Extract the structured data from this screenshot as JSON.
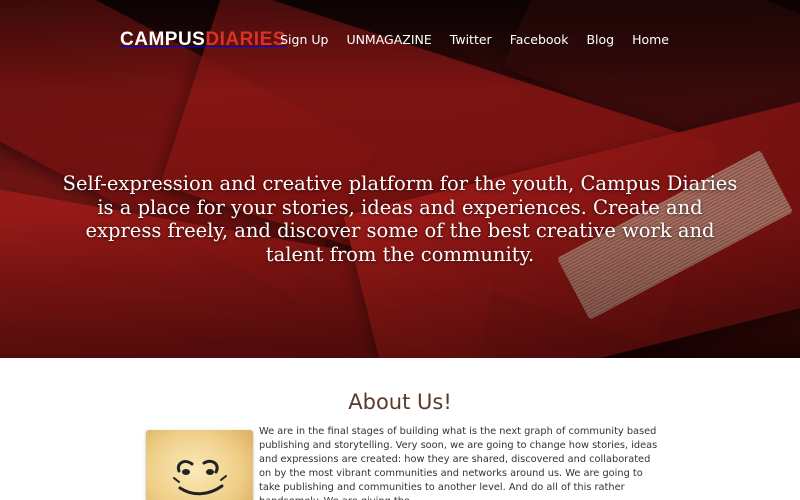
{
  "header": {
    "logo": {
      "part1": "CAMPUS",
      "part2": "DIARIES"
    },
    "nav": [
      {
        "label": "Sign Up"
      },
      {
        "label": "UNMAGAZINE"
      },
      {
        "label": "Twitter"
      },
      {
        "label": "Facebook"
      },
      {
        "label": "Blog"
      },
      {
        "label": "Home"
      }
    ]
  },
  "hero": {
    "tagline": "Self-expression and creative platform for the youth, Campus Diaries is a place for your stories, ideas and experiences. Create and express freely, and discover some of the best creative work and talent from the community."
  },
  "about": {
    "title": "About Us!",
    "body": "We are in the final stages of building what is the next graph of community based publishing and storytelling. Very soon, we are going to change how stories, ideas and expressions are created: how they are shared, discovered and collaborated on by the most vibrant communities and networks around us. We are going to take publishing and communities to another level. And do all of this rather handsomely. We are giving the"
  },
  "colors": {
    "accent_red": "#d8322a",
    "heading_brown": "#5a3a2a",
    "body_text": "#333333"
  }
}
